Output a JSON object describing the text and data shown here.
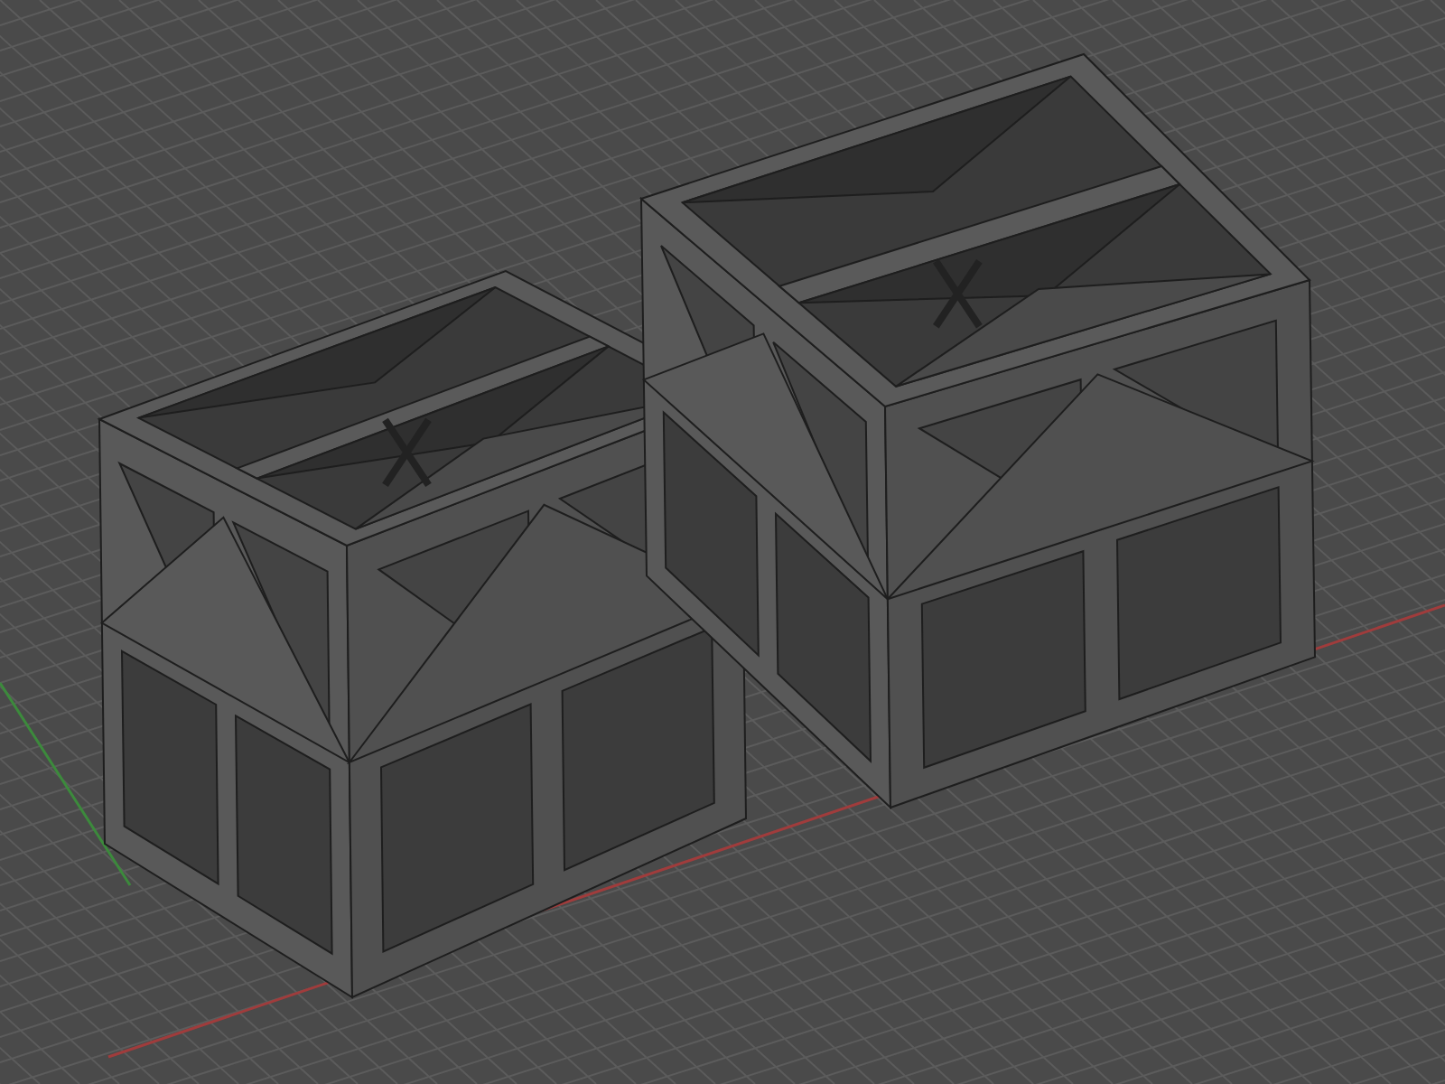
{
  "viewport": {
    "grid": true,
    "axis_lines": true,
    "models": [
      {
        "kind": "frame-cube"
      },
      {
        "kind": "frame-cube"
      }
    ]
  }
}
